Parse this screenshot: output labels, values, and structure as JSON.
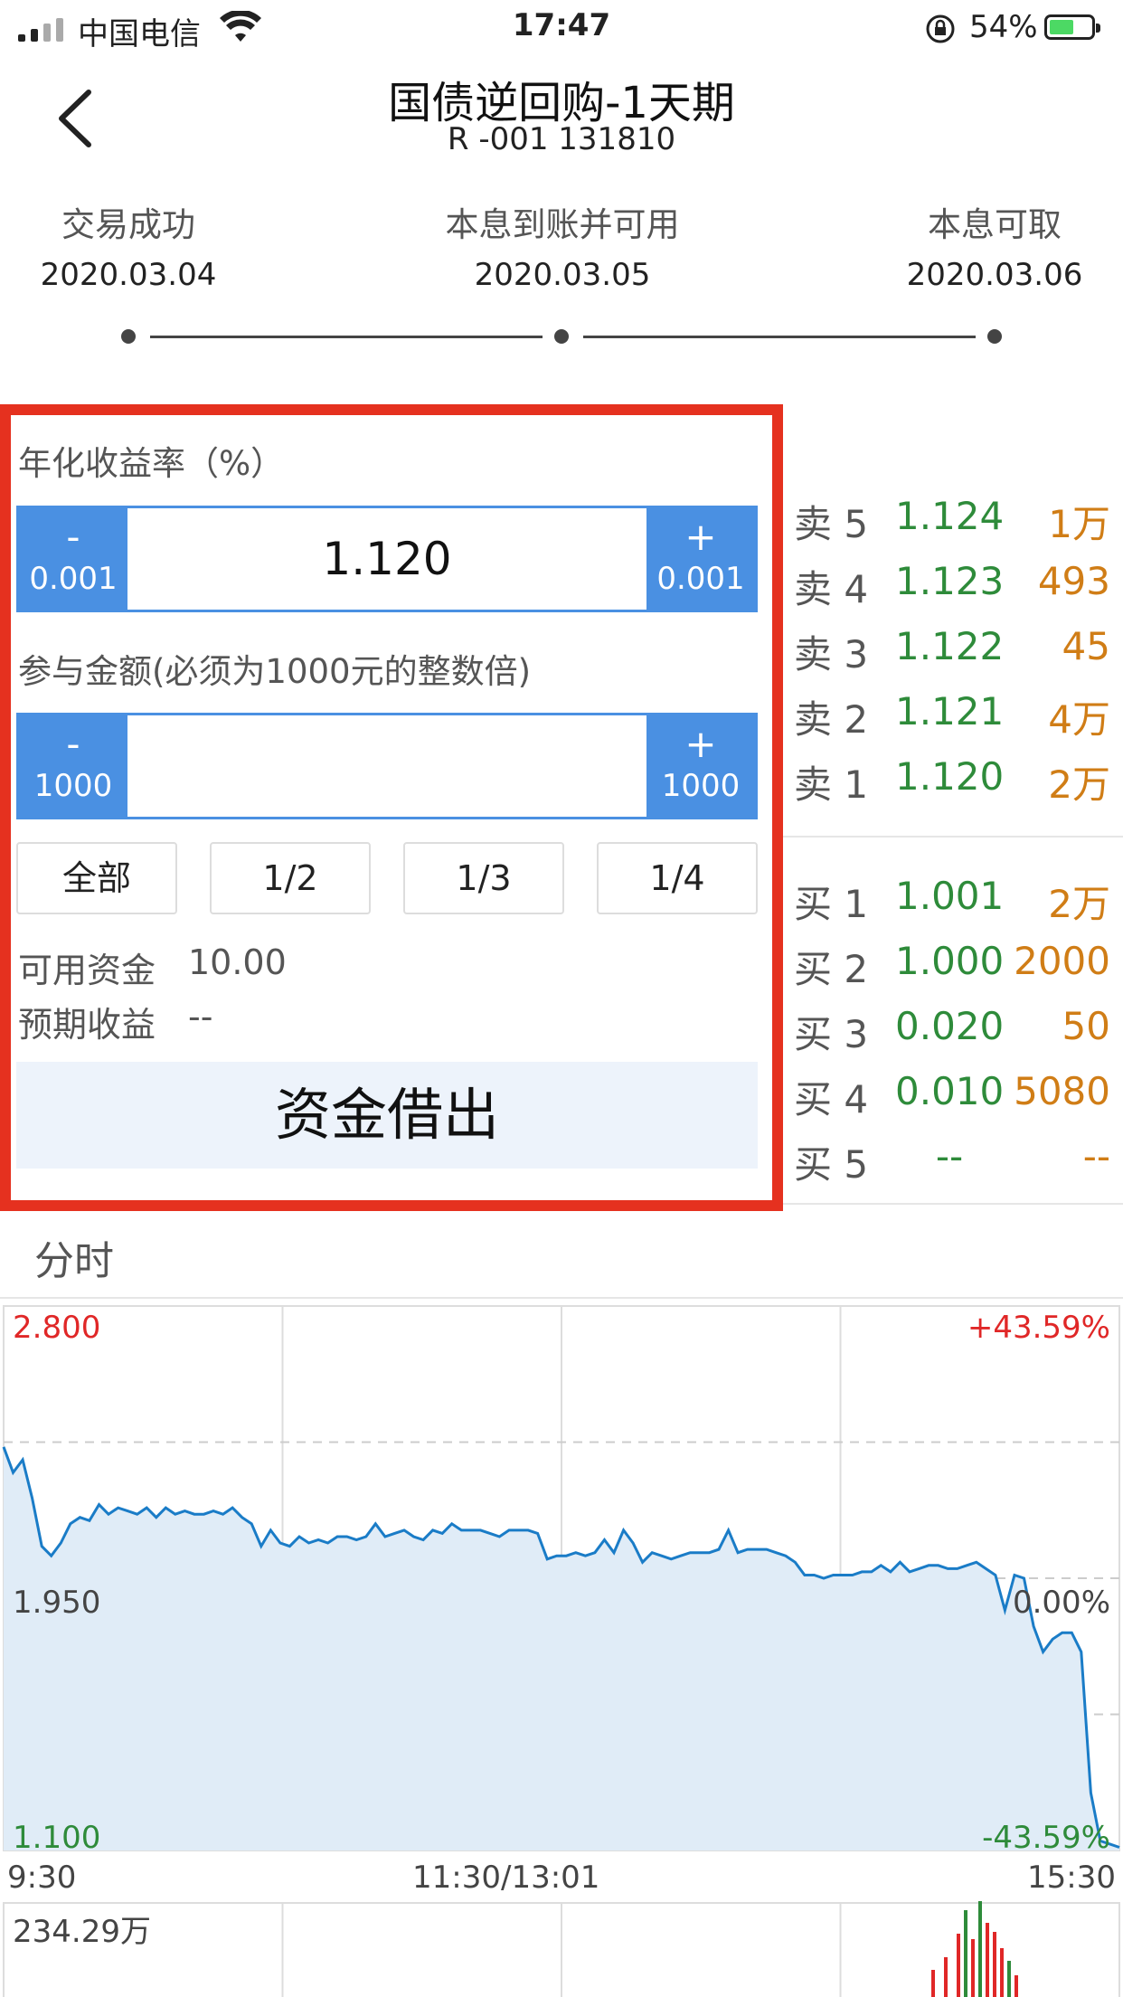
{
  "status_bar": {
    "carrier": "中国电信",
    "time": "17:47",
    "battery_percent": "54%"
  },
  "header": {
    "title": "国债逆回购-1天期",
    "subtitle": "R -001 131810"
  },
  "timeline": [
    {
      "label": "交易成功",
      "date": "2020.03.04"
    },
    {
      "label": "本息到账并可用",
      "date": "2020.03.05"
    },
    {
      "label": "本息可取",
      "date": "2020.03.06"
    }
  ],
  "order_panel": {
    "rate_label": "年化收益率（%）",
    "rate": {
      "minus": "-",
      "minus_step": "0.001",
      "value": "1.120",
      "plus": "+",
      "plus_step": "0.001"
    },
    "amount_label": "参与金额(必须为1000元的整数倍)",
    "amount": {
      "minus": "-",
      "minus_step": "1000",
      "value": "",
      "plus": "+",
      "plus_step": "1000"
    },
    "fractions": [
      "全部",
      "1/2",
      "1/3",
      "1/4"
    ],
    "available_label": "可用资金",
    "available_value": "10.00",
    "expected_label": "预期收益",
    "expected_value": "--",
    "submit_label": "资金借出"
  },
  "order_book": {
    "asks": [
      {
        "side": "卖 5",
        "price": "1.124",
        "volume": "1万"
      },
      {
        "side": "卖 4",
        "price": "1.123",
        "volume": "493"
      },
      {
        "side": "卖 3",
        "price": "1.122",
        "volume": "45"
      },
      {
        "side": "卖 2",
        "price": "1.121",
        "volume": "4万"
      },
      {
        "side": "卖 1",
        "price": "1.120",
        "volume": "2万"
      }
    ],
    "bids": [
      {
        "side": "买 1",
        "price": "1.001",
        "volume": "2万"
      },
      {
        "side": "买 2",
        "price": "1.000",
        "volume": "2000"
      },
      {
        "side": "买 3",
        "price": "0.020",
        "volume": "50"
      },
      {
        "side": "买 4",
        "price": "0.010",
        "volume": "5080"
      },
      {
        "side": "买 5",
        "price": "--",
        "volume": "--"
      }
    ]
  },
  "intraday": {
    "title": "分时",
    "y_top": "2.800",
    "y_mid": "1.950",
    "y_bottom": "1.100",
    "pct_top": "+43.59%",
    "pct_mid": "0.00%",
    "pct_bottom": "-43.59%",
    "x_start": "9:30",
    "x_mid": "11:30/13:01",
    "x_end": "15:30",
    "volume_max": "234.29万"
  },
  "colors": {
    "accent_blue": "#4a90e2",
    "highlight_red": "#e5311f",
    "price_green": "#2e8b3a",
    "volume_orange": "#d07d16",
    "line_blue": "#1a7cc7",
    "area_fill": "#e0ecf7"
  },
  "chart_data": {
    "type": "area",
    "title": "分时",
    "xlabel": "",
    "ylabel": "",
    "ylim": [
      1.1,
      2.8
    ],
    "x_ticks": [
      "9:30",
      "11:30/13:01",
      "15:30"
    ],
    "y_ticks": [
      "2.800",
      "1.950",
      "1.100"
    ],
    "pct_ticks": [
      "+43.59%",
      "0.00%",
      "-43.59%"
    ],
    "grid": true,
    "series": [
      {
        "values": [
          2.36,
          2.28,
          2.32,
          2.2,
          2.05,
          2.02,
          2.06,
          2.12,
          2.14,
          2.13,
          2.18,
          2.15,
          2.17,
          2.16,
          2.15,
          2.17,
          2.14,
          2.17,
          2.15,
          2.16,
          2.15,
          2.15,
          2.16,
          2.15,
          2.17,
          2.14,
          2.12,
          2.05,
          2.1,
          2.06,
          2.05,
          2.08,
          2.06,
          2.07,
          2.06,
          2.08,
          2.08,
          2.07,
          2.08,
          2.12,
          2.08,
          2.09,
          2.1,
          2.08,
          2.07,
          2.1,
          2.09,
          2.12,
          2.1,
          2.1,
          2.1,
          2.09,
          2.08,
          2.1,
          2.1,
          2.1,
          2.09,
          2.01,
          2.02,
          2.02,
          2.03,
          2.02,
          2.03,
          2.07,
          2.03,
          2.1,
          2.06,
          2.0,
          2.03,
          2.02,
          2.01,
          2.02,
          2.03,
          2.03,
          2.03,
          2.04,
          2.1,
          2.03,
          2.04,
          2.04,
          2.04,
          2.03,
          2.02,
          2.0,
          1.96,
          1.96,
          1.95,
          1.96,
          1.96,
          1.96,
          1.97,
          1.97,
          1.99,
          1.97,
          2.0,
          1.97,
          1.98,
          1.99,
          1.99,
          1.98,
          1.98,
          1.99,
          2.0,
          1.98,
          1.96,
          1.85,
          1.96,
          1.95,
          1.8,
          1.72,
          1.76,
          1.78,
          1.78,
          1.72,
          1.28,
          1.13,
          1.12,
          1.11
        ]
      }
    ],
    "volume_axis_label": "234.29万"
  }
}
